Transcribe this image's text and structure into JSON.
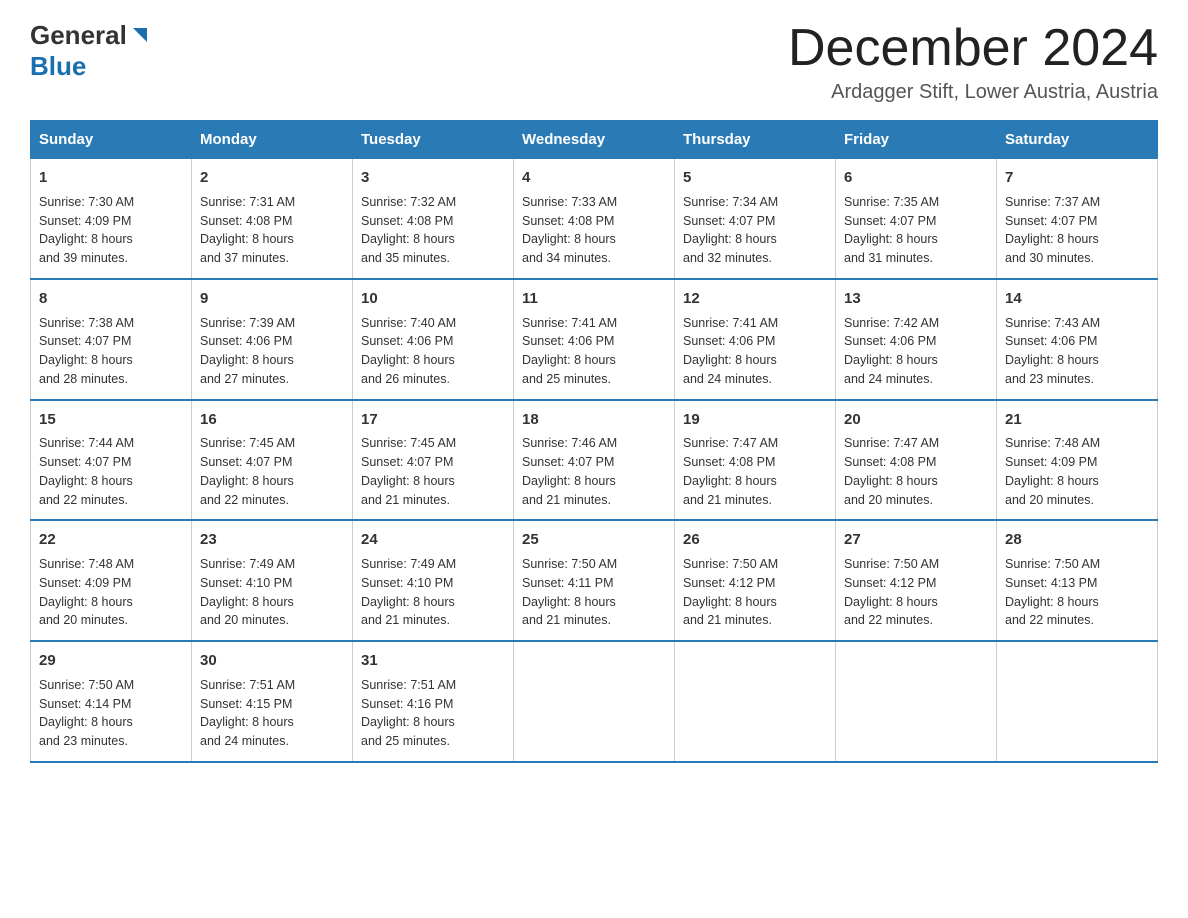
{
  "header": {
    "logo_general": "General",
    "logo_blue": "Blue",
    "month_title": "December 2024",
    "location": "Ardagger Stift, Lower Austria, Austria"
  },
  "days_of_week": [
    "Sunday",
    "Monday",
    "Tuesday",
    "Wednesday",
    "Thursday",
    "Friday",
    "Saturday"
  ],
  "weeks": [
    [
      {
        "day": "1",
        "sunrise": "7:30 AM",
        "sunset": "4:09 PM",
        "daylight": "8 hours and 39 minutes."
      },
      {
        "day": "2",
        "sunrise": "7:31 AM",
        "sunset": "4:08 PM",
        "daylight": "8 hours and 37 minutes."
      },
      {
        "day": "3",
        "sunrise": "7:32 AM",
        "sunset": "4:08 PM",
        "daylight": "8 hours and 35 minutes."
      },
      {
        "day": "4",
        "sunrise": "7:33 AM",
        "sunset": "4:08 PM",
        "daylight": "8 hours and 34 minutes."
      },
      {
        "day": "5",
        "sunrise": "7:34 AM",
        "sunset": "4:07 PM",
        "daylight": "8 hours and 32 minutes."
      },
      {
        "day": "6",
        "sunrise": "7:35 AM",
        "sunset": "4:07 PM",
        "daylight": "8 hours and 31 minutes."
      },
      {
        "day": "7",
        "sunrise": "7:37 AM",
        "sunset": "4:07 PM",
        "daylight": "8 hours and 30 minutes."
      }
    ],
    [
      {
        "day": "8",
        "sunrise": "7:38 AM",
        "sunset": "4:07 PM",
        "daylight": "8 hours and 28 minutes."
      },
      {
        "day": "9",
        "sunrise": "7:39 AM",
        "sunset": "4:06 PM",
        "daylight": "8 hours and 27 minutes."
      },
      {
        "day": "10",
        "sunrise": "7:40 AM",
        "sunset": "4:06 PM",
        "daylight": "8 hours and 26 minutes."
      },
      {
        "day": "11",
        "sunrise": "7:41 AM",
        "sunset": "4:06 PM",
        "daylight": "8 hours and 25 minutes."
      },
      {
        "day": "12",
        "sunrise": "7:41 AM",
        "sunset": "4:06 PM",
        "daylight": "8 hours and 24 minutes."
      },
      {
        "day": "13",
        "sunrise": "7:42 AM",
        "sunset": "4:06 PM",
        "daylight": "8 hours and 24 minutes."
      },
      {
        "day": "14",
        "sunrise": "7:43 AM",
        "sunset": "4:06 PM",
        "daylight": "8 hours and 23 minutes."
      }
    ],
    [
      {
        "day": "15",
        "sunrise": "7:44 AM",
        "sunset": "4:07 PM",
        "daylight": "8 hours and 22 minutes."
      },
      {
        "day": "16",
        "sunrise": "7:45 AM",
        "sunset": "4:07 PM",
        "daylight": "8 hours and 22 minutes."
      },
      {
        "day": "17",
        "sunrise": "7:45 AM",
        "sunset": "4:07 PM",
        "daylight": "8 hours and 21 minutes."
      },
      {
        "day": "18",
        "sunrise": "7:46 AM",
        "sunset": "4:07 PM",
        "daylight": "8 hours and 21 minutes."
      },
      {
        "day": "19",
        "sunrise": "7:47 AM",
        "sunset": "4:08 PM",
        "daylight": "8 hours and 21 minutes."
      },
      {
        "day": "20",
        "sunrise": "7:47 AM",
        "sunset": "4:08 PM",
        "daylight": "8 hours and 20 minutes."
      },
      {
        "day": "21",
        "sunrise": "7:48 AM",
        "sunset": "4:09 PM",
        "daylight": "8 hours and 20 minutes."
      }
    ],
    [
      {
        "day": "22",
        "sunrise": "7:48 AM",
        "sunset": "4:09 PM",
        "daylight": "8 hours and 20 minutes."
      },
      {
        "day": "23",
        "sunrise": "7:49 AM",
        "sunset": "4:10 PM",
        "daylight": "8 hours and 20 minutes."
      },
      {
        "day": "24",
        "sunrise": "7:49 AM",
        "sunset": "4:10 PM",
        "daylight": "8 hours and 21 minutes."
      },
      {
        "day": "25",
        "sunrise": "7:50 AM",
        "sunset": "4:11 PM",
        "daylight": "8 hours and 21 minutes."
      },
      {
        "day": "26",
        "sunrise": "7:50 AM",
        "sunset": "4:12 PM",
        "daylight": "8 hours and 21 minutes."
      },
      {
        "day": "27",
        "sunrise": "7:50 AM",
        "sunset": "4:12 PM",
        "daylight": "8 hours and 22 minutes."
      },
      {
        "day": "28",
        "sunrise": "7:50 AM",
        "sunset": "4:13 PM",
        "daylight": "8 hours and 22 minutes."
      }
    ],
    [
      {
        "day": "29",
        "sunrise": "7:50 AM",
        "sunset": "4:14 PM",
        "daylight": "8 hours and 23 minutes."
      },
      {
        "day": "30",
        "sunrise": "7:51 AM",
        "sunset": "4:15 PM",
        "daylight": "8 hours and 24 minutes."
      },
      {
        "day": "31",
        "sunrise": "7:51 AM",
        "sunset": "4:16 PM",
        "daylight": "8 hours and 25 minutes."
      },
      null,
      null,
      null,
      null
    ]
  ],
  "labels": {
    "sunrise": "Sunrise:",
    "sunset": "Sunset:",
    "daylight": "Daylight:"
  }
}
